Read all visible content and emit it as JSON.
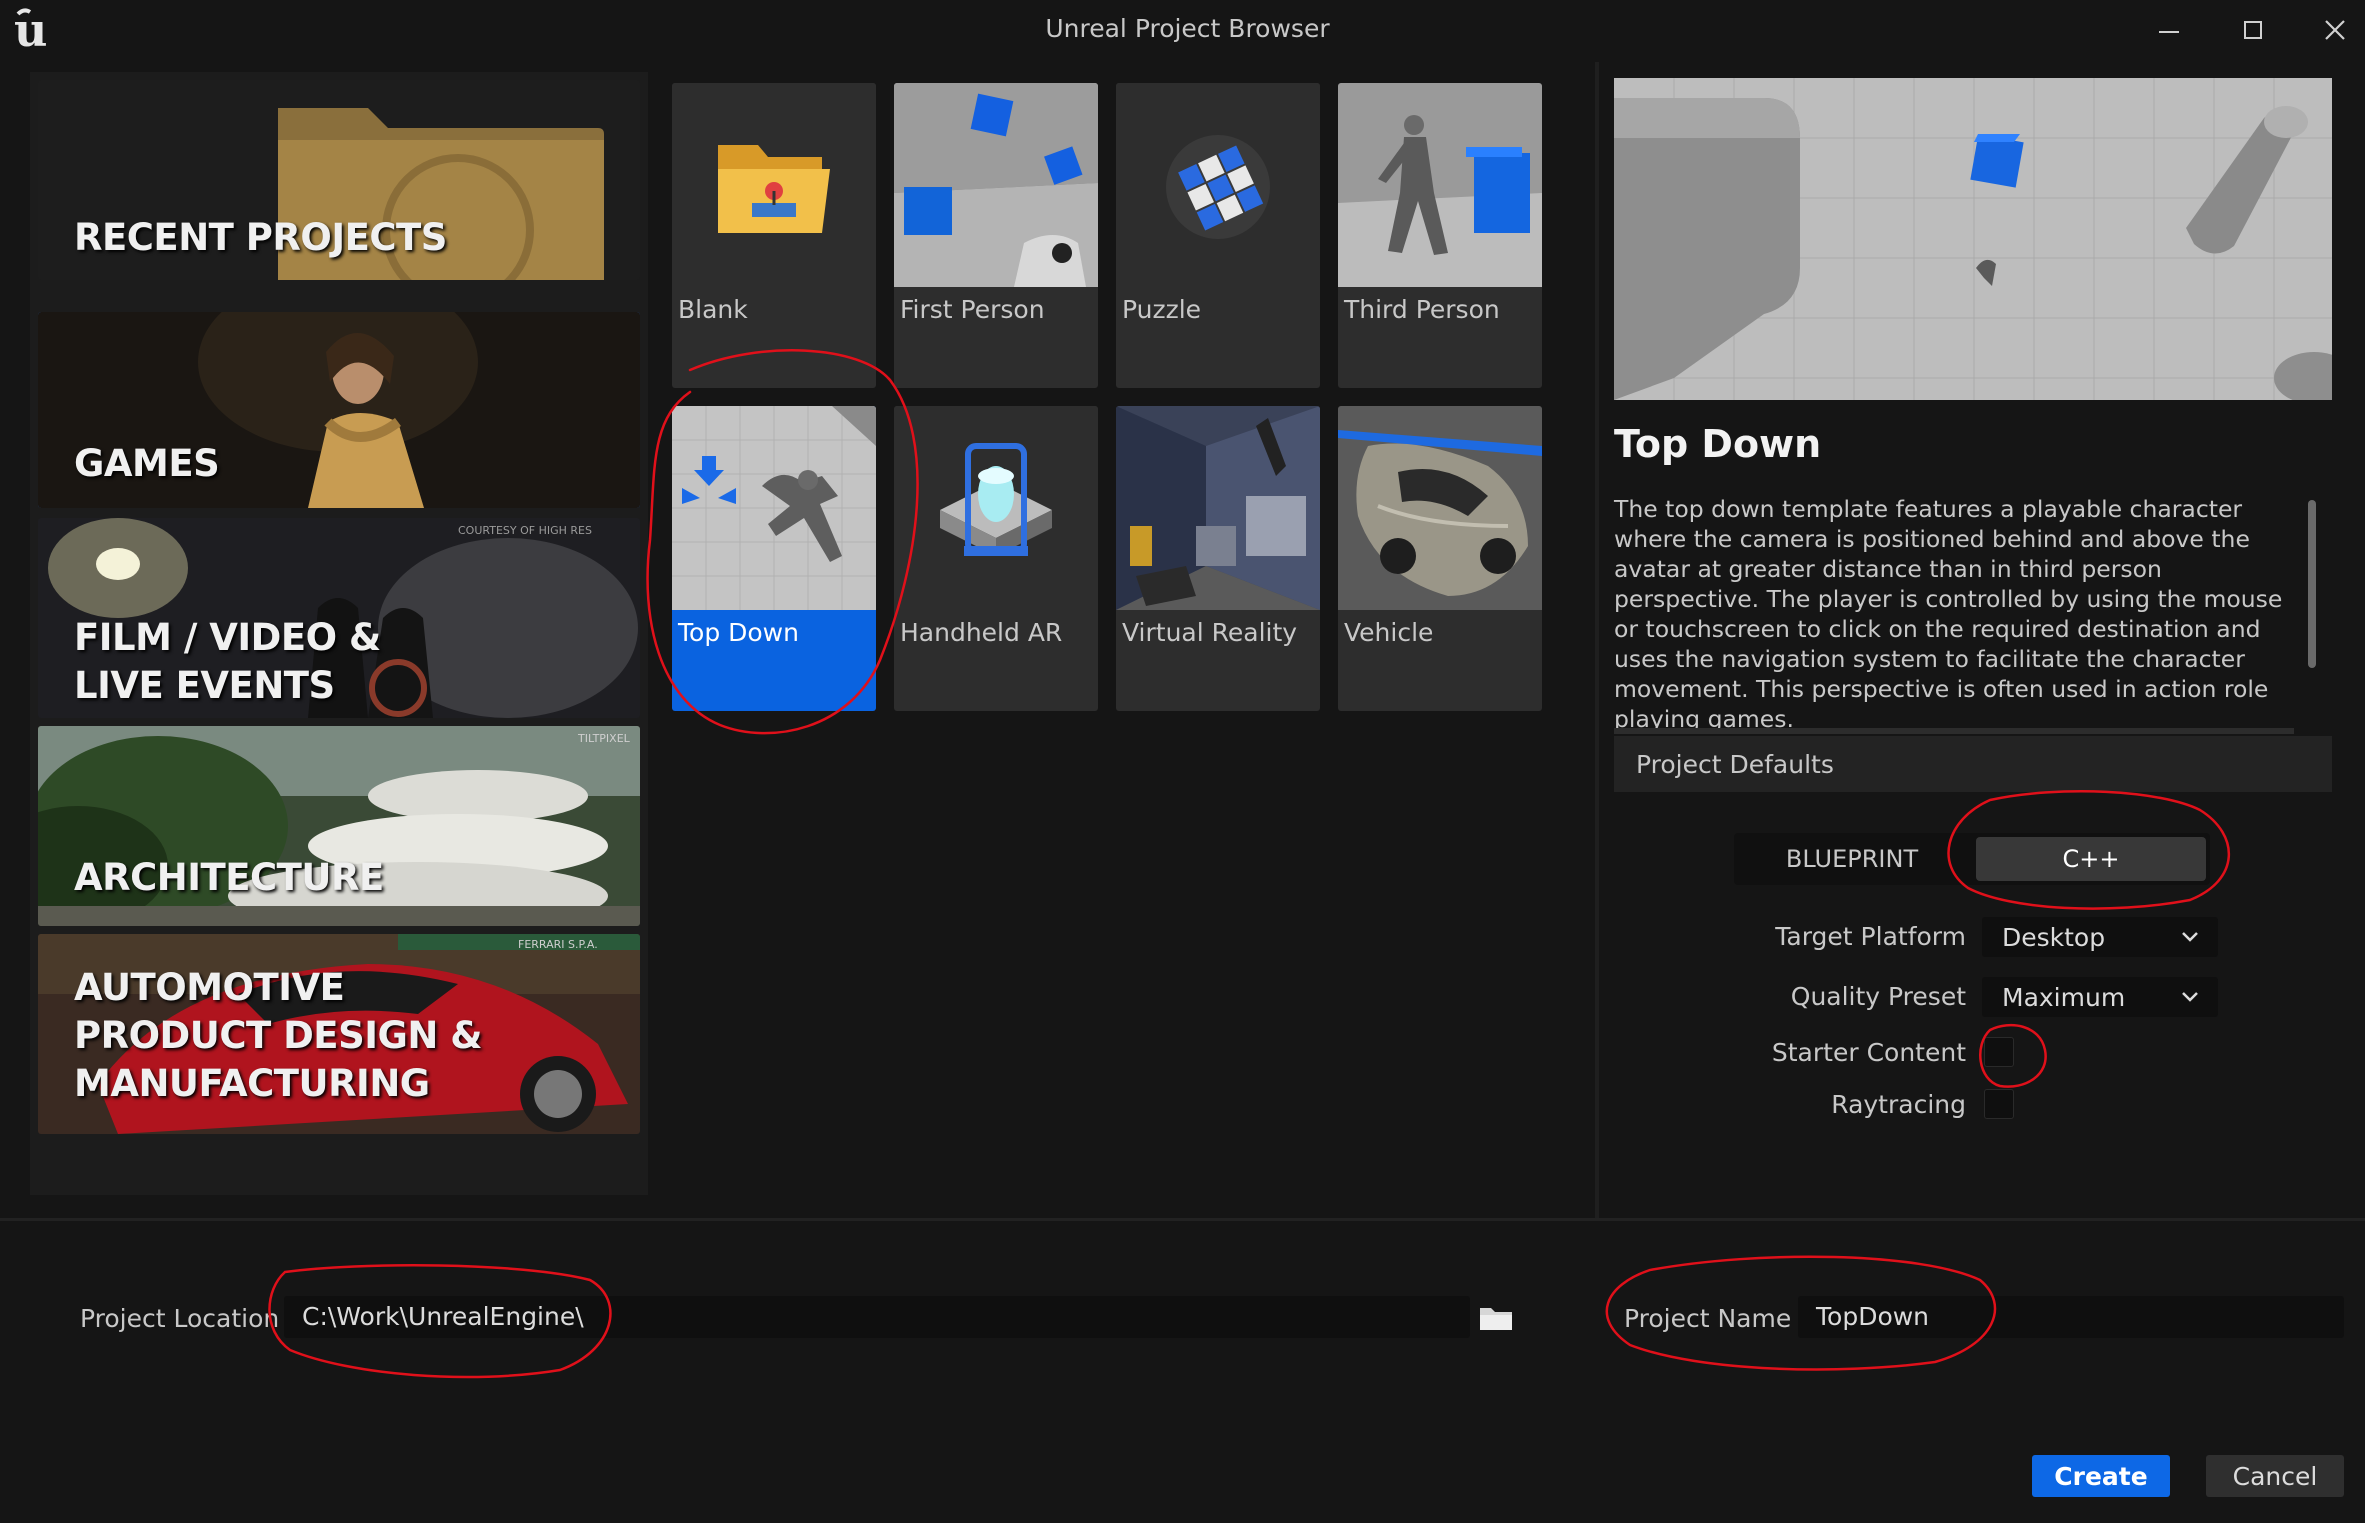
{
  "window": {
    "title": "Unreal Project Browser",
    "minimize_icon": "minimize-icon",
    "maximize_icon": "maximize-icon",
    "close_icon": "close-icon"
  },
  "categories": [
    {
      "label": "RECENT PROJECTS",
      "selected": false
    },
    {
      "label": "GAMES",
      "selected": true
    },
    {
      "label_lines": [
        "FILM / VIDEO &",
        "LIVE EVENTS"
      ],
      "selected": false,
      "credit": "COURTESY OF HIGH RES"
    },
    {
      "label": "ARCHITECTURE",
      "selected": false,
      "credit": "TILTPIXEL"
    },
    {
      "label_lines": [
        "AUTOMOTIVE",
        "PRODUCT DESIGN &",
        "MANUFACTURING"
      ],
      "selected": false,
      "credit": "FERRARI S.P.A."
    }
  ],
  "templates": [
    {
      "name": "Blank",
      "selected": false
    },
    {
      "name": "First Person",
      "selected": false
    },
    {
      "name": "Puzzle",
      "selected": false
    },
    {
      "name": "Third Person",
      "selected": false
    },
    {
      "name": "Top Down",
      "selected": true
    },
    {
      "name": "Handheld AR",
      "selected": false
    },
    {
      "name": "Virtual Reality",
      "selected": false
    },
    {
      "name": "Vehicle",
      "selected": false
    }
  ],
  "detail": {
    "title": "Top Down",
    "description": "The top down template features a playable character where the camera is positioned behind and above the avatar at greater distance than in third person perspective. The player is controlled by using the mouse or touchscreen to click on the required destination and uses the navigation system to facilitate the character movement. This perspective is often used in action role playing games."
  },
  "project_defaults": {
    "header": "Project Defaults",
    "mode_options": [
      "BLUEPRINT",
      "C++"
    ],
    "mode_selected": "C++",
    "target_platform": {
      "label": "Target Platform",
      "value": "Desktop"
    },
    "quality_preset": {
      "label": "Quality Preset",
      "value": "Maximum"
    },
    "starter_content": {
      "label": "Starter Content",
      "checked": false
    },
    "raytracing": {
      "label": "Raytracing",
      "checked": false
    }
  },
  "bottom": {
    "location_label": "Project Location",
    "location_value": "C:\\Work\\UnrealEngine\\",
    "folder_icon": "folder-icon",
    "name_label": "Project Name",
    "name_value": "TopDown",
    "create_label": "Create",
    "cancel_label": "Cancel"
  },
  "colors": {
    "accent": "#0d68e6",
    "background": "#151515",
    "annotation": "#e0101a"
  }
}
